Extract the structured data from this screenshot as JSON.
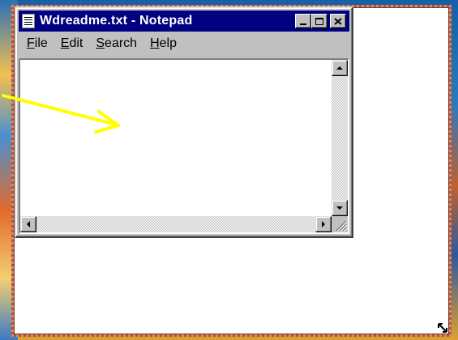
{
  "window": {
    "title": "Wdreadme.txt - Notepad",
    "icon": "notepad-icon"
  },
  "menu": [
    {
      "label": "File",
      "mnemonic": "F",
      "rest": "ile"
    },
    {
      "label": "Edit",
      "mnemonic": "E",
      "rest": "dit"
    },
    {
      "label": "Search",
      "mnemonic": "S",
      "rest": "earch"
    },
    {
      "label": "Help",
      "mnemonic": "H",
      "rest": "elp"
    }
  ],
  "editor": {
    "content": ""
  },
  "colors": {
    "titlebar": "#000080",
    "annotation_arrow": "#ffff00",
    "resize_outline": "#b0553c"
  }
}
